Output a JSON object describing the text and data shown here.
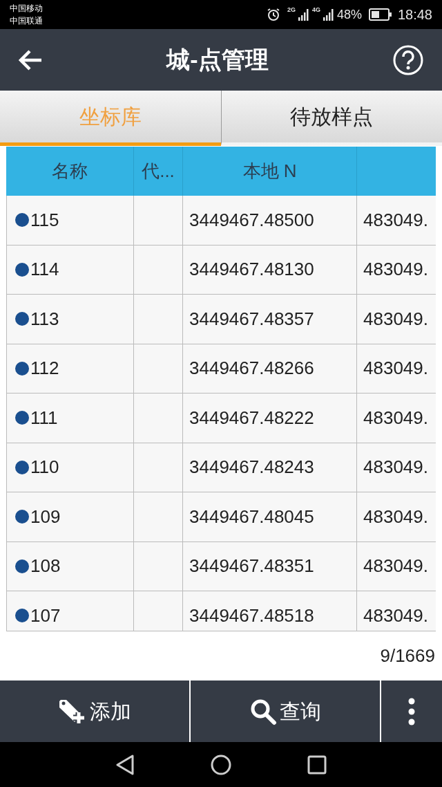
{
  "status_bar": {
    "carriers": [
      "中国移动",
      "中国联通"
    ],
    "network_1": "2G",
    "network_2": "4G",
    "battery": "48%",
    "time": "18:48"
  },
  "header": {
    "title": "城-点管理"
  },
  "tabs": [
    {
      "label": "坐标库",
      "selected": true
    },
    {
      "label": "待放样点",
      "selected": false
    }
  ],
  "table": {
    "columns": [
      "名称",
      "代...",
      "本地 N",
      ""
    ],
    "rows": [
      {
        "name": "115",
        "color": "#1a4f8f",
        "column_2": "",
        "n": "3449467.48500",
        "column_4": "483049."
      },
      {
        "name": "114",
        "color": "#1a4f8f",
        "column_2": "",
        "n": "3449467.48130",
        "column_4": "483049."
      },
      {
        "name": "113",
        "color": "#1a4f8f",
        "column_2": "",
        "n": "3449467.48357",
        "column_4": "483049."
      },
      {
        "name": "112",
        "color": "#1a4f8f",
        "column_2": "",
        "n": "3449467.48266",
        "column_4": "483049."
      },
      {
        "name": "111",
        "color": "#1a4f8f",
        "column_2": "",
        "n": "3449467.48222",
        "column_4": "483049."
      },
      {
        "name": "110",
        "color": "#1a4f8f",
        "column_2": "",
        "n": "3449467.48243",
        "column_4": "483049."
      },
      {
        "name": "109",
        "color": "#1a4f8f",
        "column_2": "",
        "n": "3449467.48045",
        "column_4": "483049."
      },
      {
        "name": "108",
        "color": "#1a4f8f",
        "column_2": "",
        "n": "3449467.48351",
        "column_4": "483049."
      },
      {
        "name": "107",
        "color": "#1a4f8f",
        "column_2": "",
        "n": "3449467.48518",
        "column_4": "483049."
      }
    ]
  },
  "page_count": "9/1669",
  "bottom_bar": [
    {
      "kind": "add",
      "label": "添加"
    },
    {
      "kind": "search",
      "label": "查询"
    },
    {
      "kind": "more"
    }
  ]
}
